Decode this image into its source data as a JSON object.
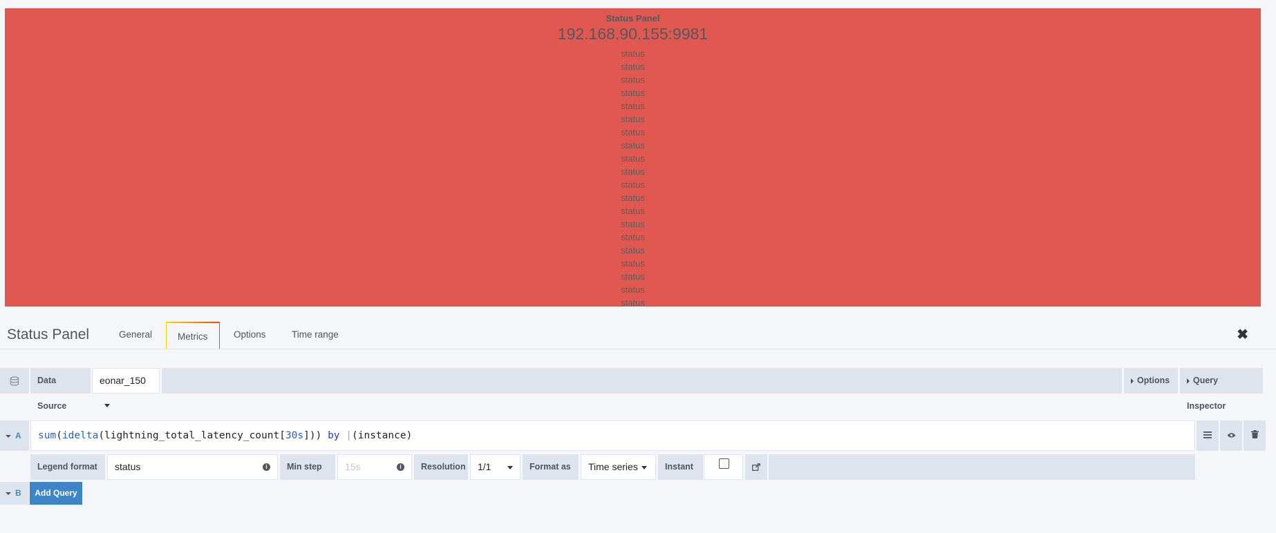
{
  "panel": {
    "title": "Status Panel",
    "host": "192.168.90.155:9981",
    "status_lines": [
      "status",
      "status",
      "status",
      "status",
      "status",
      "status",
      "status",
      "status",
      "status",
      "status",
      "status",
      "status",
      "status",
      "status",
      "status",
      "status",
      "status",
      "status",
      "status",
      "status"
    ],
    "background": "#e0584f"
  },
  "editor": {
    "title": "Status Panel",
    "tabs": [
      "General",
      "Metrics",
      "Options",
      "Time range"
    ],
    "active_tab": "Metrics",
    "close_icon": "close-icon"
  },
  "datasource": {
    "label": "Data Source",
    "value": "eonar_150",
    "options_label": "Options",
    "query_inspector_label": "Query Inspector"
  },
  "queries": {
    "a_letter": "A",
    "a_expr": {
      "fn1": "sum",
      "p1": "(",
      "fn2": "idelta",
      "p2": "(lightning_total_latency_count[",
      "num": "30s",
      "p3": "])) ",
      "by": "by",
      "p4": " ",
      "cursor": "|",
      "p5": "(instance)"
    },
    "legend_format_label": "Legend format",
    "legend_format_value": "status",
    "min_step_label": "Min step",
    "min_step_placeholder": "15s",
    "resolution_label": "Resolution",
    "resolution_value": "1/1",
    "format_as_label": "Format as",
    "format_as_value": "Time series",
    "instant_label": "Instant",
    "b_letter": "B",
    "add_query_label": "Add Query"
  }
}
